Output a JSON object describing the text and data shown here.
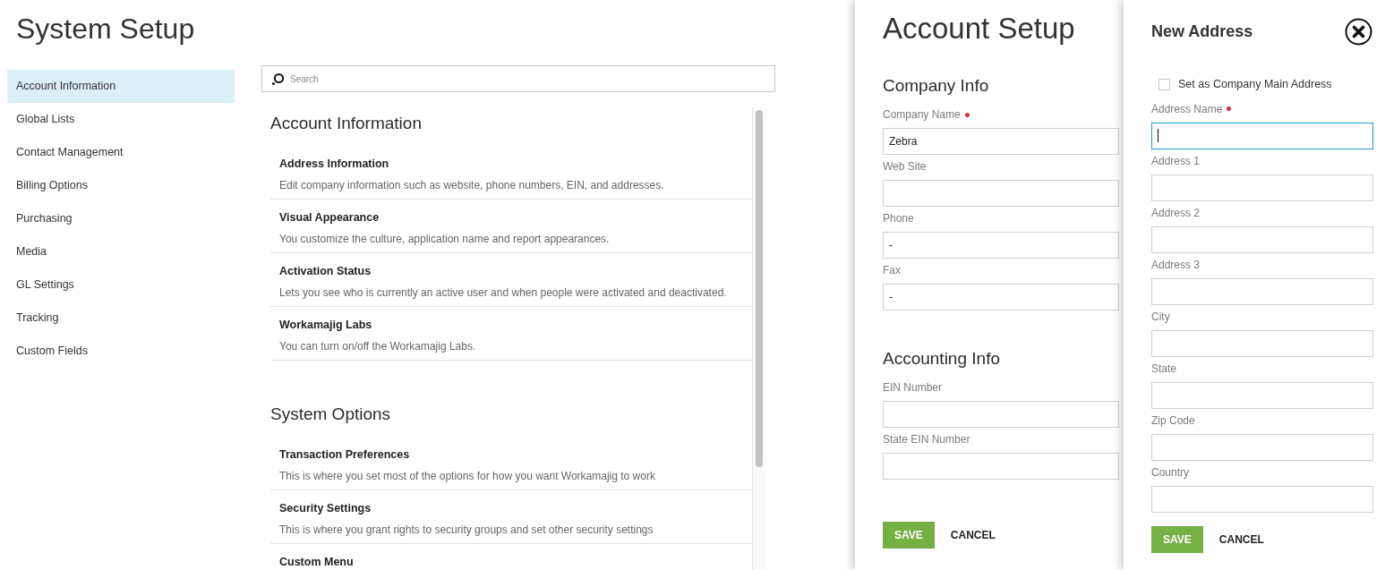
{
  "page": {
    "title": "System Setup"
  },
  "sidebar": {
    "items": [
      {
        "label": "Account Information",
        "selected": true
      },
      {
        "label": "Global Lists",
        "selected": false
      },
      {
        "label": "Contact Management",
        "selected": false
      },
      {
        "label": "Billing Options",
        "selected": false
      },
      {
        "label": "Purchasing",
        "selected": false
      },
      {
        "label": "Media",
        "selected": false
      },
      {
        "label": "GL Settings",
        "selected": false
      },
      {
        "label": "Tracking",
        "selected": false
      },
      {
        "label": "Custom Fields",
        "selected": false
      }
    ]
  },
  "search": {
    "placeholder": "Search"
  },
  "sections": [
    {
      "heading": "Account Information",
      "items": [
        {
          "title": "Address Information",
          "description": "Edit company information such as website, phone numbers, EIN, and addresses."
        },
        {
          "title": "Visual Appearance",
          "description": "You customize the culture, application name and report appearances."
        },
        {
          "title": "Activation Status",
          "description": "Lets you see who is currently an active user and when people were activated and deactivated."
        },
        {
          "title": "Workamajig Labs",
          "description": "You can turn on/off the Workamajig Labs."
        }
      ]
    },
    {
      "heading": "System Options",
      "items": [
        {
          "title": "Transaction Preferences",
          "description": "This is where you set most of the options for how you want Workamajig to work"
        },
        {
          "title": "Security Settings",
          "description": "This is where you grant rights to security groups and set other security settings"
        },
        {
          "title": "Custom Menu"
        }
      ]
    }
  ],
  "account_setup": {
    "title": "Account Setup",
    "groups": [
      {
        "heading": "Company Info",
        "fields": [
          {
            "label": "Company Name",
            "required": true,
            "value": "Zebra"
          },
          {
            "label": "Web Site",
            "required": false
          },
          {
            "label": "Phone",
            "required": false,
            "value": "-"
          },
          {
            "label": "Fax",
            "required": false,
            "value": "-"
          }
        ]
      },
      {
        "heading": "Accounting Info",
        "fields": [
          {
            "label": "EIN Number",
            "required": false
          },
          {
            "label": "State EIN Number",
            "required": false
          }
        ]
      }
    ],
    "buttons": [
      "SAVE",
      "CANCEL"
    ]
  },
  "new_address": {
    "title": "New Address",
    "main_address": {
      "label": "Set as Company Main Address",
      "checked": false
    },
    "fields": [
      {
        "label": "Address Name",
        "required": true,
        "focused": true
      },
      {
        "label": "Address 1",
        "required": false,
        "focused": false
      },
      {
        "label": "Address 2",
        "required": false,
        "focused": false
      },
      {
        "label": "Address 3",
        "required": false,
        "focused": false
      },
      {
        "label": "City",
        "required": false,
        "focused": false
      },
      {
        "label": "State",
        "required": false,
        "focused": false
      },
      {
        "label": "Zip Code",
        "required": false,
        "focused": false
      },
      {
        "label": "Country",
        "required": false,
        "focused": false
      }
    ],
    "buttons": [
      "SAVE",
      "CANCEL"
    ]
  }
}
